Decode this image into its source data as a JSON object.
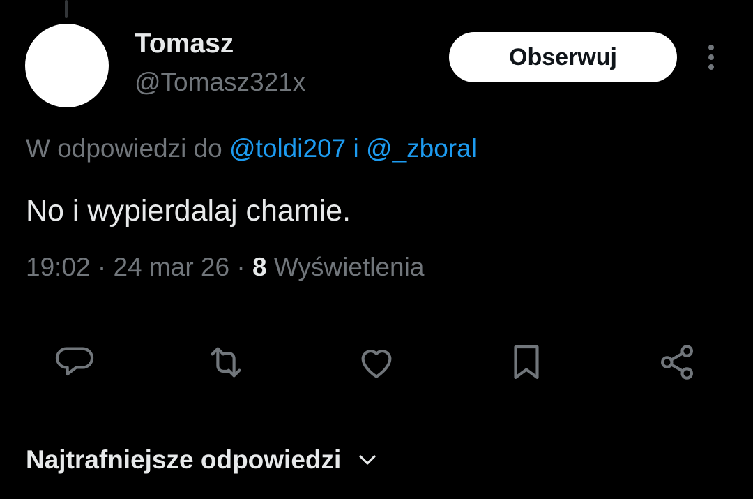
{
  "tweet": {
    "author": {
      "display_name": "Tomasz",
      "handle": "@Tomasz321x"
    },
    "follow_label": "Obserwuj",
    "reply_prefix": "W odpowiedzi do",
    "reply_mentions": [
      "@toldi207",
      "@_zboral"
    ],
    "reply_joiner": "i",
    "text": "No i wypierdalaj chamie.",
    "time": "19:02",
    "date": "24 mar 26",
    "separator": "·",
    "views_count": "8",
    "views_label": "Wyświetlenia"
  },
  "actions": {
    "reply_icon": "reply-icon",
    "retweet_icon": "retweet-icon",
    "like_icon": "like-icon",
    "bookmark_icon": "bookmark-icon",
    "share_icon": "share-icon"
  },
  "replies_sort": {
    "label": "Najtrafniejsze odpowiedzi",
    "icon": "chevron-down-icon"
  },
  "colors": {
    "background": "#000000",
    "primary_text": "#e7e9ea",
    "secondary_text": "#71767b",
    "accent": "#1d9bf0",
    "icon": "#71767b"
  }
}
